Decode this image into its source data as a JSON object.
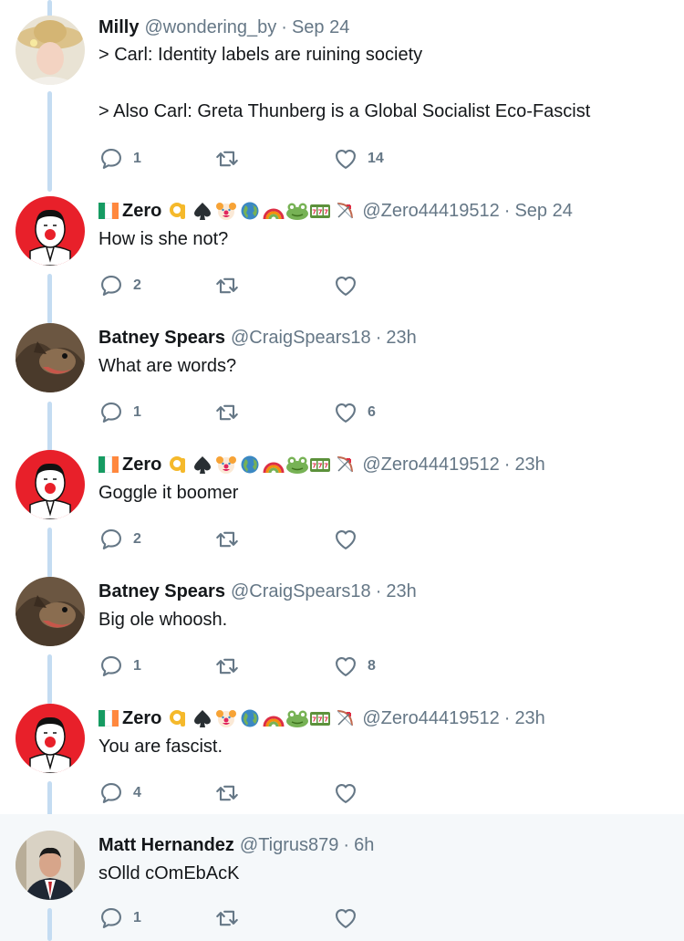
{
  "tweets": [
    {
      "name": "Milly",
      "handle": "@wondering_by",
      "time": "Sep 24",
      "text": "> Carl: Identity labels are ruining society\n\n> Also Carl: Greta Thunberg is a Global Socialist Eco-Fascist",
      "replies": "1",
      "retweets": "",
      "likes": "14",
      "avatar": "straw-hat-avatar"
    },
    {
      "name": "Zero",
      "handle": "@Zero44419512",
      "time": "Sep 24",
      "text": "How is she not?",
      "replies": "2",
      "retweets": "",
      "likes": "",
      "avatar": "clown-nose-avatar"
    },
    {
      "name": "Batney Spears",
      "handle": "@CraigSpears18",
      "time": "23h",
      "text": "What are words?",
      "replies": "1",
      "retweets": "",
      "likes": "6",
      "avatar": "bat-avatar"
    },
    {
      "name": "Zero",
      "handle": "@Zero44419512",
      "time": "23h",
      "text": "Goggle it boomer",
      "replies": "2",
      "retweets": "",
      "likes": "",
      "avatar": "clown-nose-avatar"
    },
    {
      "name": "Batney Spears",
      "handle": "@CraigSpears18",
      "time": "23h",
      "text": "Big ole whoosh.",
      "replies": "1",
      "retweets": "",
      "likes": "8",
      "avatar": "bat-avatar"
    },
    {
      "name": "Zero",
      "handle": "@Zero44419512",
      "time": "23h",
      "text": "You are fascist.",
      "replies": "4",
      "retweets": "",
      "likes": "",
      "avatar": "clown-nose-avatar"
    },
    {
      "name": "Matt Hernandez",
      "handle": "@Tigrus879",
      "time": "6h",
      "text": "sOlld cOmEbAcK",
      "replies": "1",
      "retweets": "",
      "likes": "",
      "avatar": "suit-avatar"
    }
  ],
  "separator": "·",
  "zero_name_emojis": [
    "ireland-flag",
    "ok-hand",
    "spade",
    "clown",
    "globe",
    "rainbow",
    "frog",
    "slot-machine",
    "bow-and-arrow"
  ],
  "colors": {
    "thread_line": "#c4dcf2",
    "secondary_text": "#657786",
    "primary_text": "#14171a",
    "highlight_bg": "#f5f8fa"
  }
}
